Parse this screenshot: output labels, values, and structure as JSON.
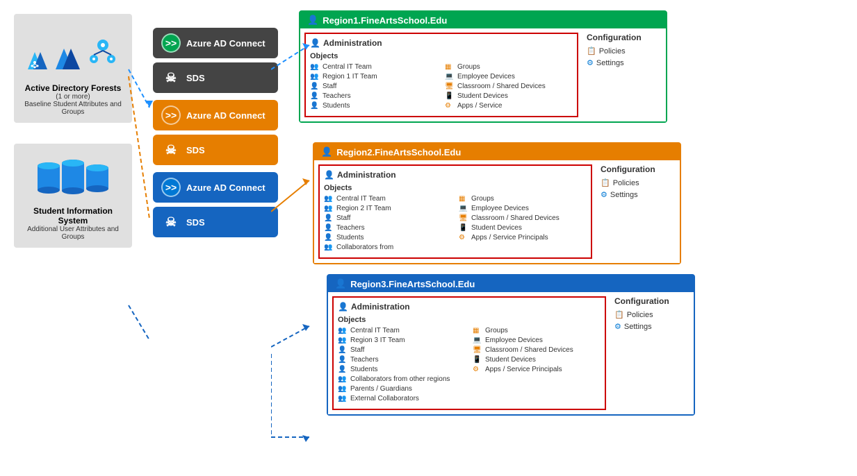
{
  "left": {
    "ad_label": "Active Directory Forests",
    "ad_sublabel": "(1 or more)",
    "ad_desc": "Baseline Student Attributes and Groups",
    "sis_label": "Student Information System",
    "sis_desc": "Additional User Attributes and Groups"
  },
  "middle": {
    "azure_label": "Azure AD Connect",
    "sds_label": "SDS"
  },
  "regions": [
    {
      "id": "region1",
      "domain": "Region1.FineArtsSchool.Edu",
      "color": "green",
      "admin_title": "Administration",
      "objects_label": "Objects",
      "left_objects": [
        "Central IT Team",
        "Region 1 IT Team",
        "Staff",
        "Teachers",
        "Students"
      ],
      "right_objects": [
        "Groups",
        "Employee Devices",
        "Classroom / Shared Devices",
        "Student Devices",
        "Apps / Service"
      ],
      "config_title": "Configuration",
      "config_items": [
        "Policies",
        "Settings"
      ]
    },
    {
      "id": "region2",
      "domain": "Region2.FineArtsSchool.Edu",
      "color": "orange",
      "admin_title": "Administration",
      "objects_label": "Objects",
      "left_objects": [
        "Central IT Team",
        "Region 2 IT Team",
        "Staff",
        "Teachers",
        "Students",
        "Collaborators from"
      ],
      "right_objects": [
        "Groups",
        "Employee Devices",
        "Classroom / Shared Devices",
        "Student Devices",
        "Apps / Service Principals"
      ],
      "config_title": "Configuration",
      "config_items": [
        "Policies",
        "Settings"
      ]
    },
    {
      "id": "region3",
      "domain": "Region3.FineArtsSchool.Edu",
      "color": "blue",
      "admin_title": "Administration",
      "objects_label": "Objects",
      "left_objects": [
        "Central IT Team",
        "Region 3 IT Team",
        "Staff",
        "Teachers",
        "Students",
        "Collaborators from other regions",
        "Parents / Guardians",
        "External Collaborators"
      ],
      "right_objects": [
        "Groups",
        "Employee Devices",
        "Classroom / Shared Devices",
        "Student Devices",
        "Apps / Service Principals"
      ],
      "config_title": "Configuration",
      "config_items": [
        "Policies",
        "Settings"
      ]
    }
  ]
}
